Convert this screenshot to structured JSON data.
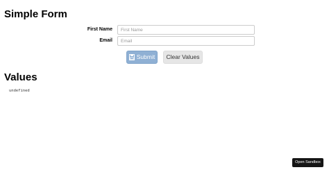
{
  "form": {
    "title": "Simple Form",
    "fields": [
      {
        "label": "First Name",
        "placeholder": "First Name",
        "value": ""
      },
      {
        "label": "Email",
        "placeholder": "Email",
        "value": ""
      }
    ],
    "submit_label": "Submit",
    "submit_icon": "save-icon",
    "clear_label": "Clear Values"
  },
  "values": {
    "title": "Values",
    "output": "undefined"
  },
  "sandbox": {
    "label": "Open Sandbox"
  },
  "colors": {
    "submit_bg": "#8fb0d4",
    "clear_bg": "#e6e6e6",
    "sandbox_bg": "#151515"
  }
}
